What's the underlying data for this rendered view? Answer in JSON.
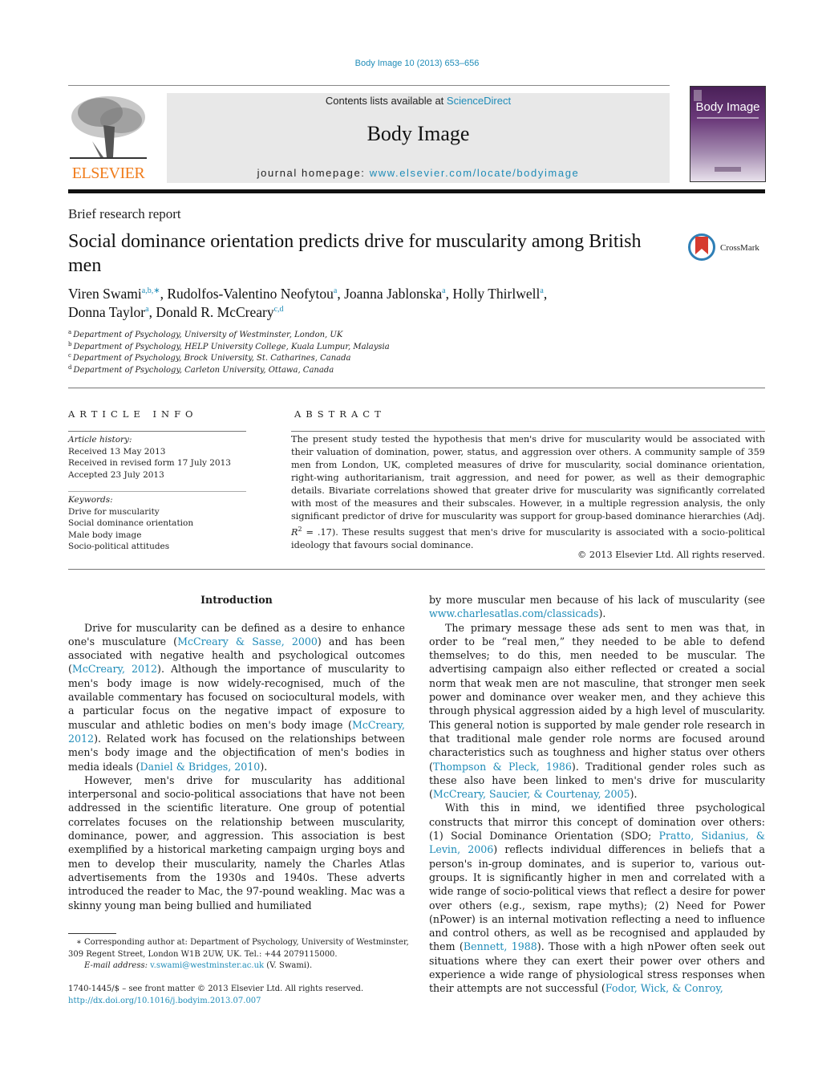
{
  "header": {
    "journal_ref": "Body Image 10 (2013) 653–656",
    "contents_prefix": "Contents lists available at ",
    "contents_link": "ScienceDirect",
    "journal_title": "Body Image",
    "homepage_prefix": "journal homepage: ",
    "homepage_link": "www.elsevier.com/locate/bodyimage",
    "publisher_logo": "ELSEVIER",
    "cover_title": "Body Image",
    "crossmark_label": "CrossMark"
  },
  "article": {
    "type": "Brief research report",
    "title": "Social dominance orientation predicts drive for muscularity among British men",
    "authors": [
      {
        "name": "Viren Swami",
        "sup": "a,b,∗"
      },
      {
        "name": "Rudolfos-Valentino Neofytou",
        "sup": "a"
      },
      {
        "name": "Joanna Jablonska",
        "sup": "a"
      },
      {
        "name": "Holly Thirlwell",
        "sup": "a"
      },
      {
        "name": "Donna Taylor",
        "sup": "a"
      },
      {
        "name": "Donald R. McCreary",
        "sup": "c,d"
      }
    ],
    "affiliations": [
      {
        "key": "a",
        "text": "Department of Psychology, University of Westminster, London, UK"
      },
      {
        "key": "b",
        "text": "Department of Psychology, HELP University College, Kuala Lumpur, Malaysia"
      },
      {
        "key": "c",
        "text": "Department of Psychology, Brock University, St. Catharines, Canada"
      },
      {
        "key": "d",
        "text": "Department of Psychology, Carleton University, Ottawa, Canada"
      }
    ]
  },
  "article_info": {
    "heading": "ARTICLE INFO",
    "history_label": "Article history:",
    "history": [
      "Received 13 May 2013",
      "Received in revised form 17 July 2013",
      "Accepted 23 July 2013"
    ],
    "keywords_label": "Keywords:",
    "keywords": [
      "Drive for muscularity",
      "Social dominance orientation",
      "Male body image",
      "Socio-political attitudes"
    ]
  },
  "abstract": {
    "heading": "ABSTRACT",
    "text_1": "The present study tested the hypothesis that men's drive for muscularity would be associated with their valuation of domination, power, status, and aggression over others. A community sample of 359 men from London, UK, completed measures of drive for muscularity, social dominance orientation, right-wing authoritarianism, trait aggression, and need for power, as well as their demographic details. Bivariate correlations showed that greater drive for muscularity was significantly correlated with most of the measures and their subscales. However, in a multiple regression analysis, the only significant predictor of drive for muscularity was support for group-based dominance hierarchies (Adj. ",
    "r_symbol": "R",
    "r_exp": "2",
    "text_2": " = .17). These results suggest that men's drive for muscularity is associated with a socio-political ideology that favours social dominance.",
    "copyright": "© 2013 Elsevier Ltd. All rights reserved."
  },
  "body": {
    "intro_heading": "Introduction",
    "p1": [
      {
        "t": "Drive for muscularity can be defined as a desire to enhance one's musculature ("
      },
      {
        "link": "McCreary & Sasse, 2000"
      },
      {
        "t": ") and has been associated with negative health and psychological outcomes ("
      },
      {
        "link": "McCreary, 2012"
      },
      {
        "t": "). Although the importance of muscularity to men's body image is now widely-recognised, much of the available commentary has focused on sociocultural models, with a particular focus on the negative impact of exposure to muscular and athletic bodies on men's body image ("
      },
      {
        "link": "McCreary, 2012"
      },
      {
        "t": "). Related work has focused on the relationships between men's body image and the objectification of men's bodies in media ideals ("
      },
      {
        "link": "Daniel & Bridges, 2010"
      },
      {
        "t": ")."
      }
    ],
    "p2": "However, men's drive for muscularity has additional interpersonal and socio-political associations that have not been addressed in the scientific literature. One group of potential correlates focuses on the relationship between muscularity, dominance, power, and aggression. This association is best exemplified by a historical marketing campaign urging boys and men to develop their muscularity, namely the Charles Atlas advertisements from the 1930s and 1940s. These adverts introduced the reader to Mac, the 97-pound weakling. Mac was a skinny young man being bullied and humiliated",
    "p2_cont": [
      {
        "t": "by more muscular men because of his lack of muscularity (see "
      },
      {
        "link": "www.charlesatlas.com/classicads"
      },
      {
        "t": ")."
      }
    ],
    "p3": [
      {
        "t": "The primary message these ads sent to men was that, in order to be “real men,” they needed to be able to defend themselves; to do this, men needed to be muscular. The advertising campaign also either reflected or created a social norm that weak men are not masculine, that stronger men seek power and dominance over weaker men, and they achieve this through physical aggression aided by a high level of muscularity. This general notion is supported by male gender role research in that traditional male gender role norms are focused around characteristics such as toughness and higher status over others ("
      },
      {
        "link": "Thompson & Pleck, 1986"
      },
      {
        "t": "). Traditional gender roles such as these also have been linked to men's drive for muscularity ("
      },
      {
        "link": "McCreary, Saucier, & Courtenay, 2005"
      },
      {
        "t": ")."
      }
    ],
    "p4": [
      {
        "t": "With this in mind, we identified three psychological constructs that mirror this concept of domination over others: (1) Social Dominance Orientation (SDO; "
      },
      {
        "link": "Pratto, Sidanius, & Levin, 2006"
      },
      {
        "t": ") reflects individual differences in beliefs that a person's in-group dominates, and is superior to, various out-groups. It is significantly higher in men and correlated with a wide range of socio-political views that reflect a desire for power over others (e.g., sexism, rape myths); (2) Need for Power (nPower) is an internal motivation reflecting a need to influence and control others, as well as be recognised and applauded by them ("
      },
      {
        "link": "Bennett, 1988"
      },
      {
        "t": "). Those with a high nPower often seek out situations where they can exert their power over others and experience a wide range of physiological stress responses when their attempts are not successful ("
      },
      {
        "link": "Fodor, Wick, & Conroy,"
      }
    ]
  },
  "footnotes": {
    "corresponding": "∗ Corresponding author at: Department of Psychology, University of Westminster, 309 Regent Street, London W1B 2UW, UK. Tel.: +44 2079115000.",
    "email_label": "E-mail address: ",
    "email": "v.swami@westminster.ac.uk",
    "email_suffix": " (V. Swami).",
    "issn_line": "1740-1445/$ – see front matter © 2013 Elsevier Ltd. All rights reserved.",
    "doi": "http://dx.doi.org/10.1016/j.bodyim.2013.07.007"
  },
  "colors": {
    "link": "#1f8cb8",
    "elsevier_orange": "#f07c1b",
    "masthead_gray": "#e8e8e8",
    "cover_purple": "#4a2058",
    "crossmark_red": "#d63b2f",
    "crossmark_blue": "#2f7fb6"
  }
}
